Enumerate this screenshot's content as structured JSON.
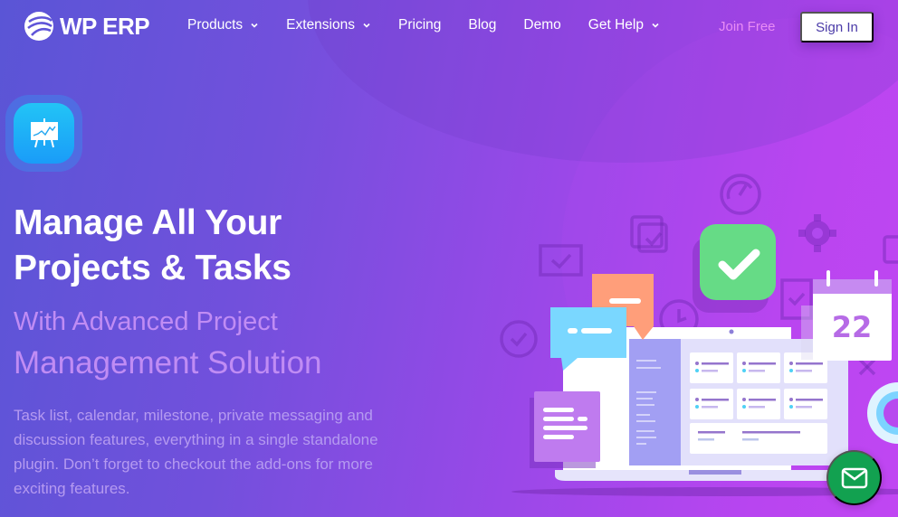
{
  "brand": {
    "name": "WP ERP"
  },
  "nav": {
    "items": [
      {
        "label": "Products",
        "has_dropdown": true
      },
      {
        "label": "Extensions",
        "has_dropdown": true
      },
      {
        "label": "Pricing",
        "has_dropdown": false
      },
      {
        "label": "Blog",
        "has_dropdown": false
      },
      {
        "label": "Demo",
        "has_dropdown": false
      },
      {
        "label": "Get Help",
        "has_dropdown": true
      }
    ],
    "join_label": "Join Free",
    "signin_label": "Sign In"
  },
  "hero": {
    "icon": "presentation-chart-icon",
    "headline_line1": "Manage All Your",
    "headline_line2": "Projects & Tasks",
    "subhead_line1": "With Advanced Project",
    "subhead_line2": "Management Solution",
    "description": "Task list, calendar, milestone, private messaging and discussion features, everything in a single standalone plugin. Don’t forget to checkout the add-ons for more exciting features."
  },
  "illustration": {
    "calendar_day": "22",
    "icons": [
      "speedometer-icon",
      "gear-icon",
      "calendar-check-icon",
      "copy-check-icon",
      "checkmark-badge-icon",
      "clipboard-check-icon",
      "check-circle-icon",
      "clock-icon",
      "refresh-icon",
      "chat-bubble-icon",
      "document-icon",
      "laptop-icon",
      "close-icon"
    ]
  },
  "chat_widget": {
    "icon": "mail-icon"
  },
  "colors": {
    "accent_green": "#12a150",
    "check_green": "#66db86",
    "signin_text": "#4b3ba8",
    "join_text": "#e98cf5",
    "subhead": "#c08cf4"
  }
}
